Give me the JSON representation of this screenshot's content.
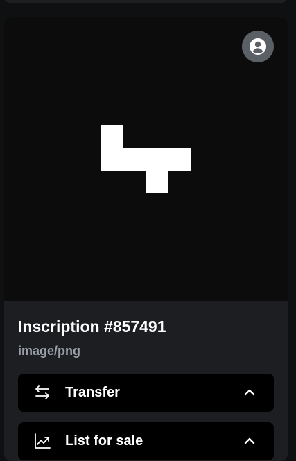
{
  "inscription": {
    "title": "Inscription #857491",
    "content_type": "image/png",
    "image": {
      "background": "#0c0c0c",
      "foreground": "#ffffff"
    }
  },
  "owner": {
    "icon": "user-circle-icon"
  },
  "actions": [
    {
      "label": "Transfer",
      "icon": "arrows-left-right-icon",
      "state_icon": "chevron-up-icon"
    },
    {
      "label": "List for sale",
      "icon": "trending-up-chart-icon",
      "state_icon": "chevron-up-icon"
    }
  ],
  "colors": {
    "page_background": "#0f1012",
    "card_background": "#1c1e22",
    "button_background": "#000000",
    "secondary_text": "#9aa0a8",
    "avatar_background": "#5b5f66"
  }
}
